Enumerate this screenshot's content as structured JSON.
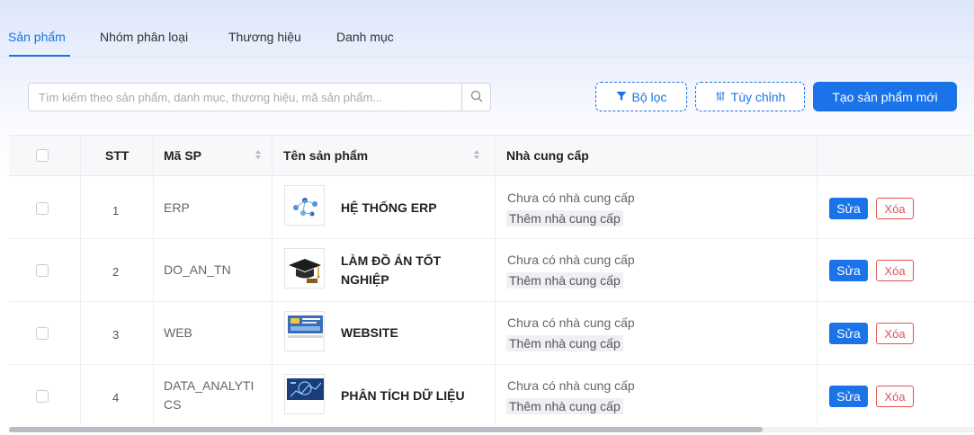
{
  "tabs": [
    {
      "label": "Sản phẩm",
      "active": true
    },
    {
      "label": "Nhóm phân loại",
      "active": false
    },
    {
      "label": "Thương hiệu",
      "active": false
    },
    {
      "label": "Danh mục",
      "active": false
    }
  ],
  "search": {
    "placeholder": "Tìm kiếm theo sản phẩm, danh mục, thương hiệu, mã sản phẩm...",
    "value": "",
    "icon": "search-icon"
  },
  "toolbar": {
    "filter_label": "Bộ lọc",
    "filter_icon": "filter-icon",
    "customize_label": "Tùy chỉnh",
    "customize_icon": "sliders-icon",
    "create_label": "Tạo sản phẩm mới"
  },
  "table": {
    "headers": {
      "stt": "STT",
      "code": "Mã SP",
      "name": "Tên sản phẩm",
      "supplier": "Nhà cung cấp",
      "actions": ""
    },
    "rows": [
      {
        "stt": "1",
        "code": "ERP",
        "name": "HỆ THỐNG ERP",
        "image_icon": "network-image",
        "supplier": "Chưa có nhà cung cấp",
        "add_supplier": "Thêm nhà cung cấp",
        "edit": "Sửa",
        "delete": "Xóa"
      },
      {
        "stt": "2",
        "code": "DO_AN_TN",
        "name": "LÀM ĐỒ ÁN TỐT NGHIỆP",
        "image_icon": "graduation-cap-image",
        "supplier": "Chưa có nhà cung cấp",
        "add_supplier": "Thêm nhà cung cấp",
        "edit": "Sửa",
        "delete": "Xóa"
      },
      {
        "stt": "3",
        "code": "WEB",
        "name": "WEBSITE",
        "image_icon": "website-image",
        "supplier": "Chưa có nhà cung cấp",
        "add_supplier": "Thêm nhà cung cấp",
        "edit": "Sửa",
        "delete": "Xóa"
      },
      {
        "stt": "4",
        "code": "DATA_ANALYTICS",
        "code_display": "DATA_ANALYTI CS",
        "name": "PHÂN TÍCH DỮ LIỆU",
        "image_icon": "data-analytics-image",
        "supplier": "Chưa có nhà cung cấp",
        "add_supplier": "Thêm nhà cung cấp",
        "edit": "Sửa",
        "delete": "Xóa"
      }
    ]
  },
  "colors": {
    "accent": "#1a73e8",
    "danger": "#e05252"
  }
}
